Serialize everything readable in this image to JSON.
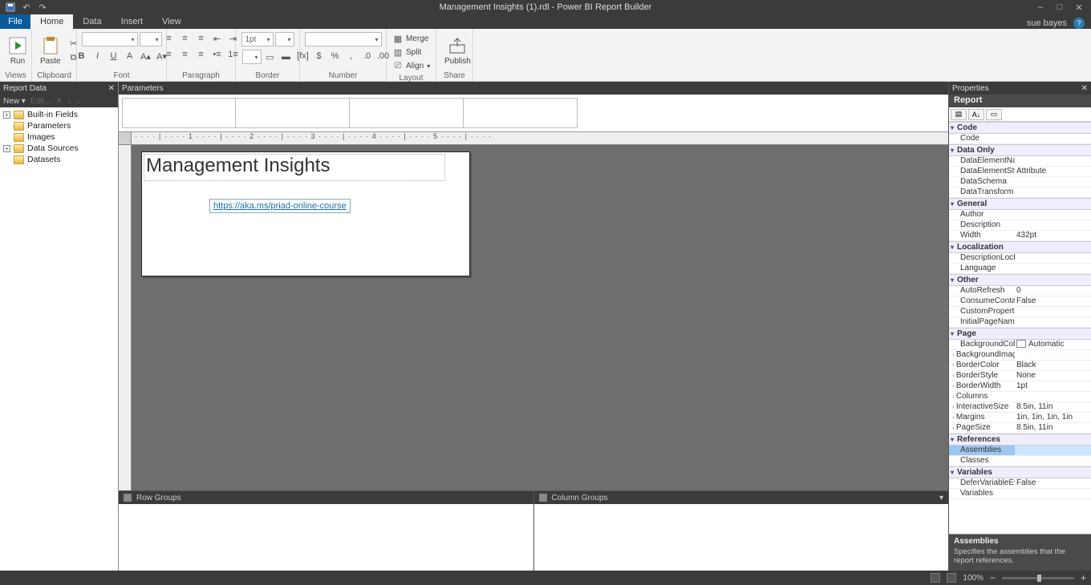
{
  "app": {
    "title": "Management Insights (1).rdl - Power BI Report Builder",
    "user": "sue bayes"
  },
  "tabs": {
    "file": "File",
    "items": [
      "Home",
      "Data",
      "Insert",
      "View"
    ],
    "active": "Home"
  },
  "ribbon": {
    "views": {
      "label": "Views",
      "run": "Run"
    },
    "clipboard": {
      "label": "Clipboard",
      "paste": "Paste"
    },
    "font": {
      "label": "Font",
      "family": "",
      "size": ""
    },
    "paragraph": {
      "label": "Paragraph"
    },
    "border": {
      "label": "Border",
      "width": "1pt",
      "color": ""
    },
    "number": {
      "label": "Number",
      "format": ""
    },
    "layout": {
      "label": "Layout",
      "merge": "Merge",
      "split": "Split",
      "align": "Align"
    },
    "share": {
      "label": "Share",
      "publish": "Publish"
    }
  },
  "report_data": {
    "title": "Report Data",
    "toolbar": {
      "new": "New",
      "edit": "Edit...",
      "del": "✕",
      "up": "↑",
      "down": "↓"
    },
    "items": [
      {
        "label": "Built-in Fields",
        "expandable": true
      },
      {
        "label": "Parameters",
        "expandable": false
      },
      {
        "label": "Images",
        "expandable": false
      },
      {
        "label": "Data Sources",
        "expandable": true
      },
      {
        "label": "Datasets",
        "expandable": false
      }
    ]
  },
  "parameters": {
    "title": "Parameters"
  },
  "design": {
    "ruler_h": "· · · · | · · · · 1 · · · · | · · · · 2 · · · · | · · · · 3 · · · · | · · · · 4 · · · · | · · · · 5 · · · · | · · · ·",
    "report_title": "Management Insights",
    "hyperlink": "https://aka.ms/priad-online-course"
  },
  "groups": {
    "row": "Row Groups",
    "col": "Column Groups"
  },
  "properties": {
    "title": "Properties",
    "selected": "Report",
    "rows": [
      {
        "cat": "Code"
      },
      {
        "n": "Code",
        "v": ""
      },
      {
        "cat": "Data Only"
      },
      {
        "n": "DataElementName",
        "v": ""
      },
      {
        "n": "DataElementStyle",
        "v": "Attribute"
      },
      {
        "n": "DataSchema",
        "v": ""
      },
      {
        "n": "DataTransform",
        "v": ""
      },
      {
        "cat": "General"
      },
      {
        "n": "Author",
        "v": ""
      },
      {
        "n": "Description",
        "v": ""
      },
      {
        "n": "Width",
        "v": "432pt"
      },
      {
        "cat": "Localization"
      },
      {
        "n": "DescriptionLocID",
        "v": ""
      },
      {
        "n": "Language",
        "v": ""
      },
      {
        "cat": "Other"
      },
      {
        "n": "AutoRefresh",
        "v": "0"
      },
      {
        "n": "ConsumeContainerWhitespace",
        "v": "False"
      },
      {
        "n": "CustomProperties",
        "v": ""
      },
      {
        "n": "InitialPageName",
        "v": ""
      },
      {
        "cat": "Page"
      },
      {
        "n": "BackgroundColor",
        "v": "Automatic",
        "swatch": true
      },
      {
        "n": "BackgroundImage",
        "v": "",
        "sub": true
      },
      {
        "n": "BorderColor",
        "v": "Black",
        "sub": true
      },
      {
        "n": "BorderStyle",
        "v": "None",
        "sub": true
      },
      {
        "n": "BorderWidth",
        "v": "1pt",
        "sub": true
      },
      {
        "n": "Columns",
        "v": "",
        "sub": true
      },
      {
        "n": "InteractiveSize",
        "v": "8.5in, 11in",
        "sub": true
      },
      {
        "n": "Margins",
        "v": "1in, 1in, 1in, 1in",
        "sub": true
      },
      {
        "n": "PageSize",
        "v": "8.5in, 11in",
        "sub": true
      },
      {
        "cat": "References"
      },
      {
        "n": "Assemblies",
        "v": "",
        "sel": true
      },
      {
        "n": "Classes",
        "v": ""
      },
      {
        "cat": "Variables"
      },
      {
        "n": "DeferVariableEvaluation",
        "v": "False"
      },
      {
        "n": "Variables",
        "v": ""
      }
    ],
    "help": {
      "title": "Assemblies",
      "desc": "Specifies the assemblies that the report references."
    }
  },
  "status": {
    "zoom": "100%"
  }
}
